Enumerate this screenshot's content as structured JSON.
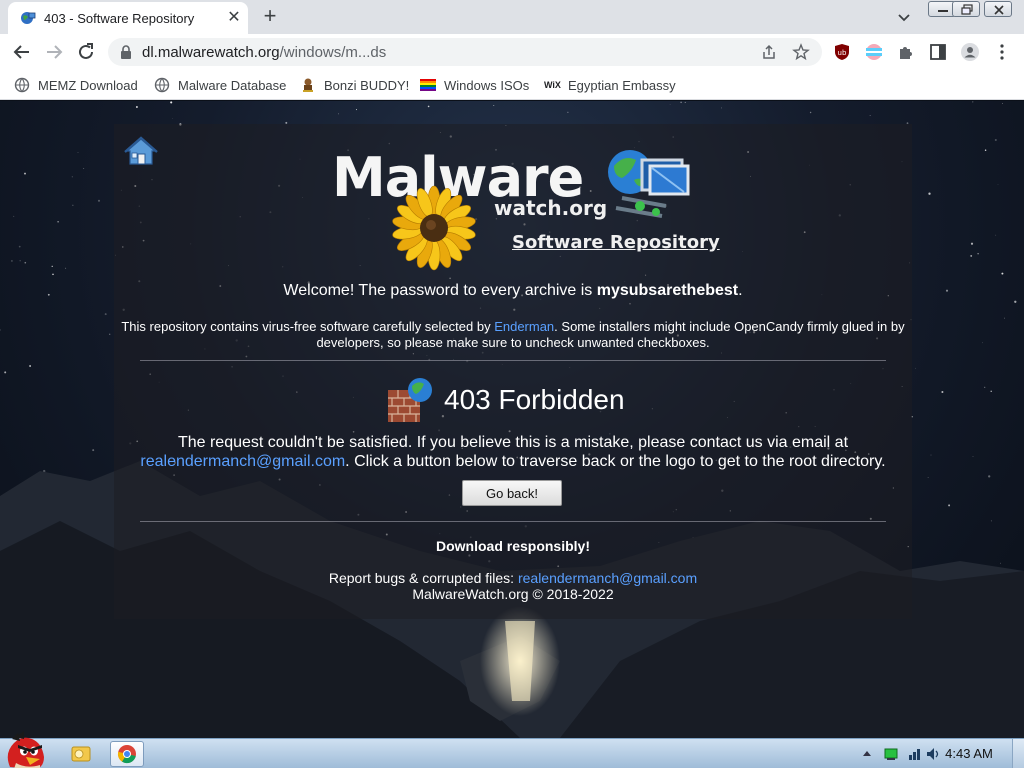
{
  "browser": {
    "tab": {
      "title": "403 - Software Repository"
    },
    "address": {
      "host": "dl.malwarewatch.org",
      "path": "/windows/m...ds"
    },
    "bookmarks": [
      {
        "label": "MEMZ Download",
        "icon": "globe-icon"
      },
      {
        "label": "Malware Database",
        "icon": "globe-icon"
      },
      {
        "label": "Bonzi BUDDY!",
        "icon": "bonzi-icon"
      },
      {
        "label": "Windows ISOs",
        "icon": "rainbow-flag-icon"
      },
      {
        "label": "Egyptian Embassy",
        "icon": "wix-icon"
      }
    ],
    "bookmark_wix_text": "WiX"
  },
  "page": {
    "logo": {
      "main": "Malware",
      "sub": "watch.org",
      "repo": "Software Repository"
    },
    "welcome": {
      "prefix": "Welcome! The password to every archive is ",
      "password": "mysubsarethebest",
      "suffix": "."
    },
    "info": {
      "prefix": "This repository contains virus-free software carefully selected by ",
      "author": "Enderman",
      "suffix": ". Some installers might include OpenCandy firmly glued in by developers, so please make sure to uncheck unwanted checkboxes."
    },
    "error": {
      "title": "403 Forbidden",
      "message_1": "The request couldn't be satisfied. If you believe this is a mistake, please contact us via email at",
      "email": "realendermanch@gmail.com",
      "message_2": ". Click a button below to traverse back or the logo to get to the root directory."
    },
    "go_back": "Go back!",
    "download_note": "Download responsibly!",
    "report": {
      "prefix": "Report bugs & corrupted files: ",
      "email": "realendermanch@gmail.com"
    },
    "copyright": "MalwareWatch.org © 2018-2022"
  },
  "taskbar": {
    "clock": "4:43 AM"
  },
  "colors": {
    "link": "#5aa0ff",
    "tab_bar": "#dee1e6",
    "taskbar": "#b7cfe6"
  }
}
